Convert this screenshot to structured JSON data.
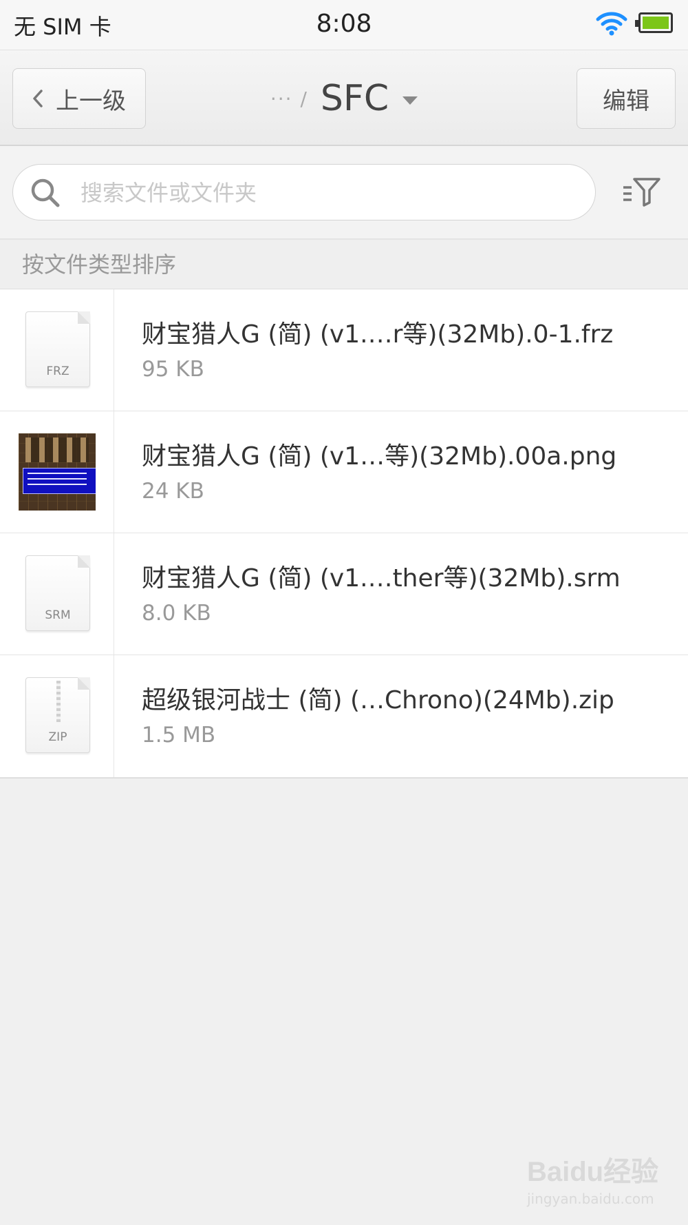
{
  "status_bar": {
    "carrier": "无 SIM 卡",
    "time": "8:08",
    "wifi_icon": "wifi-icon",
    "battery_icon": "battery-icon",
    "battery_color": "#7cc619"
  },
  "nav": {
    "back_label": "上一级",
    "breadcrumb": "··· /",
    "title": "SFC",
    "edit_label": "编辑"
  },
  "search": {
    "placeholder": "搜索文件或文件夹",
    "value": ""
  },
  "sort": {
    "label": "按文件类型排序"
  },
  "files": [
    {
      "icon": "frz-file-icon",
      "ext": "FRZ",
      "name": "财宝猎人G (简) (v1.…r等)(32Mb).0-1.frz",
      "size": "95 KB"
    },
    {
      "icon": "image-thumbnail",
      "ext": "",
      "name": "财宝猎人G (简) (v1…等)(32Mb).00a.png",
      "size": "24 KB"
    },
    {
      "icon": "srm-file-icon",
      "ext": "SRM",
      "name": "财宝猎人G (简) (v1.…ther等)(32Mb).srm",
      "size": "8.0 KB"
    },
    {
      "icon": "zip-file-icon",
      "ext": "ZIP",
      "name": "超级银河战士 (简) (…Chrono)(24Mb).zip",
      "size": "1.5 MB"
    }
  ],
  "watermark": {
    "logo": "Baidu经验",
    "url": "jingyan.baidu.com"
  }
}
